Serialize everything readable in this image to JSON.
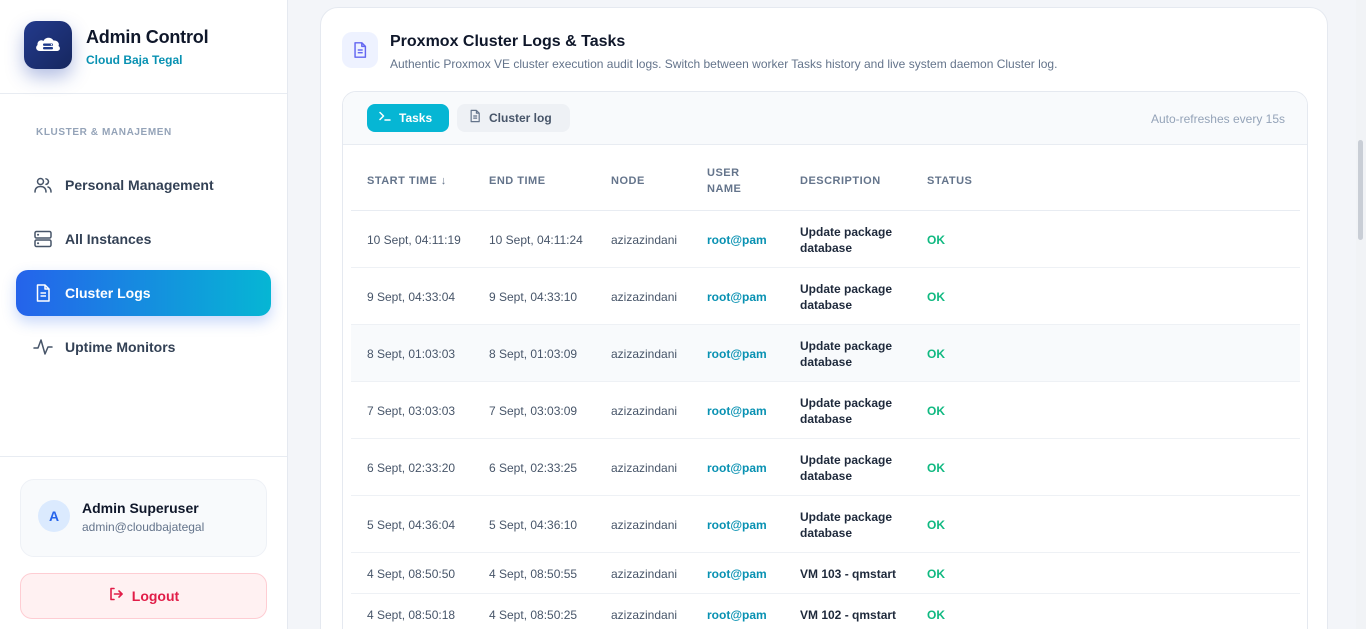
{
  "brand": {
    "title": "Admin Control",
    "subtitle": "Cloud Baja Tegal",
    "logo_icon": "cloud-server-icon"
  },
  "nav": {
    "section_label": "KLUSTER & MANAJEMEN",
    "items": [
      {
        "label": "Personal Management",
        "icon": "users-icon",
        "active": false
      },
      {
        "label": "All Instances",
        "icon": "server-icon",
        "active": false
      },
      {
        "label": "Cluster Logs",
        "icon": "document-icon",
        "active": true
      },
      {
        "label": "Uptime Monitors",
        "icon": "activity-icon",
        "active": false
      }
    ]
  },
  "user": {
    "initial": "A",
    "name": "Admin Superuser",
    "email": "admin@cloudbajategal"
  },
  "logout": {
    "label": "Logout",
    "icon": "logout-icon"
  },
  "page": {
    "title": "Proxmox Cluster Logs & Tasks",
    "description": "Authentic Proxmox VE cluster execution audit logs. Switch between worker Tasks history and live system daemon Cluster log.",
    "icon": "document-icon"
  },
  "tabs": {
    "tasks": {
      "label": "Tasks",
      "icon": "terminal-icon",
      "active": true
    },
    "cluster": {
      "label": "Cluster log",
      "icon": "document-icon",
      "active": false
    },
    "autorefresh": "Auto-refreshes every 15s"
  },
  "table": {
    "headers": {
      "start": "Start Time ↓",
      "end": "End Time",
      "node": "Node",
      "user_line1": "User",
      "user_line2": "Name",
      "description": "Description",
      "status": "Status"
    },
    "rows": [
      {
        "start": "10 Sept, 04:11:19",
        "end": "10 Sept, 04:11:24",
        "node": "azizazindani",
        "user": "root@pam",
        "description": "Update package database",
        "status": "OK"
      },
      {
        "start": "9 Sept, 04:33:04",
        "end": "9 Sept, 04:33:10",
        "node": "azizazindani",
        "user": "root@pam",
        "description": "Update package database",
        "status": "OK"
      },
      {
        "start": "8 Sept, 01:03:03",
        "end": "8 Sept, 01:03:09",
        "node": "azizazindani",
        "user": "root@pam",
        "description": "Update package database",
        "status": "OK"
      },
      {
        "start": "7 Sept, 03:03:03",
        "end": "7 Sept, 03:03:09",
        "node": "azizazindani",
        "user": "root@pam",
        "description": "Update package database",
        "status": "OK"
      },
      {
        "start": "6 Sept, 02:33:20",
        "end": "6 Sept, 02:33:25",
        "node": "azizazindani",
        "user": "root@pam",
        "description": "Update package database",
        "status": "OK"
      },
      {
        "start": "5 Sept, 04:36:04",
        "end": "5 Sept, 04:36:10",
        "node": "azizazindani",
        "user": "root@pam",
        "description": "Update package database",
        "status": "OK"
      },
      {
        "start": "4 Sept, 08:50:50",
        "end": "4 Sept, 08:50:55",
        "node": "azizazindani",
        "user": "root@pam",
        "description": "VM 103 - qmstart",
        "status": "OK"
      },
      {
        "start": "4 Sept, 08:50:18",
        "end": "4 Sept, 08:50:25",
        "node": "azizazindani",
        "user": "root@pam",
        "description": "VM 102 - qmstart",
        "status": "OK"
      }
    ]
  },
  "colors": {
    "accent": "#06b6d4",
    "primary": "#2563eb",
    "ok": "#10b981",
    "danger": "#e11d48"
  }
}
